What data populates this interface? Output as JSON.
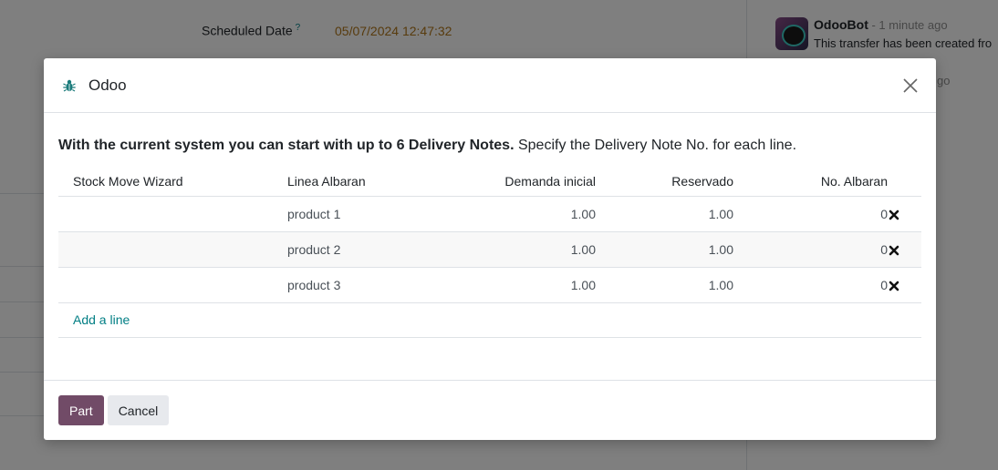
{
  "background": {
    "scheduled_date_label": "Scheduled Date",
    "help_mark": "?",
    "scheduled_date_value": "05/07/2024 12:47:32",
    "chatter": {
      "author": "OdooBot",
      "time": " - 1 minute ago",
      "message": "This transfer has been created fro",
      "second_time": "go"
    }
  },
  "modal": {
    "title": "Odoo",
    "intro_bold": "With the current system you can start with up to 6 Delivery Notes.",
    "intro_rest": " Specify the Delivery Note No. for each line.",
    "columns": [
      "Stock Move Wizard",
      "Linea Albaran",
      "Demanda inicial",
      "Reservado",
      "No. Albaran"
    ],
    "rows": [
      {
        "wizard": "",
        "line": "product 1",
        "demand": "1.00",
        "reserved": "1.00",
        "albaran": "0"
      },
      {
        "wizard": "",
        "line": "product 2",
        "demand": "1.00",
        "reserved": "1.00",
        "albaran": "0"
      },
      {
        "wizard": "",
        "line": "product 3",
        "demand": "1.00",
        "reserved": "1.00",
        "albaran": "0"
      }
    ],
    "add_line": "Add a line",
    "buttons": {
      "primary": "Part",
      "cancel": "Cancel"
    }
  },
  "colors": {
    "primary": "#714b67",
    "link": "#017e84",
    "date": "#b1761a"
  },
  "icons": {
    "header": "bug-icon",
    "close": "close-icon",
    "row_delete": "delete-x-icon"
  }
}
